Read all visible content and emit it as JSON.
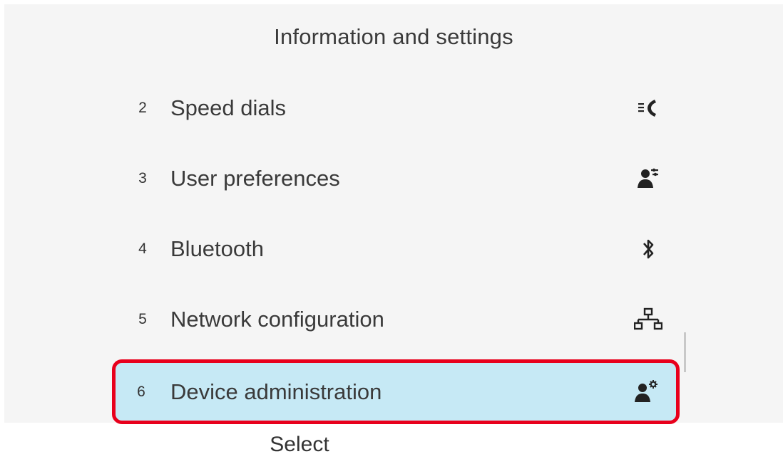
{
  "header": {
    "title": "Information and settings"
  },
  "menu": {
    "items": [
      {
        "number": "2",
        "label": "Speed dials",
        "icon": "speed-dial-icon"
      },
      {
        "number": "3",
        "label": "User preferences",
        "icon": "user-preferences-icon"
      },
      {
        "number": "4",
        "label": "Bluetooth",
        "icon": "bluetooth-icon"
      },
      {
        "number": "5",
        "label": "Network configuration",
        "icon": "network-icon"
      }
    ],
    "selected": {
      "number": "6",
      "label": "Device administration",
      "icon": "device-admin-icon"
    }
  },
  "softkeys": {
    "select_label": "Select"
  },
  "colors": {
    "background": "#f5f5f5",
    "selected_background": "#c6e9f5",
    "highlight_outline": "#e8001c",
    "text": "#3a3a3a"
  }
}
